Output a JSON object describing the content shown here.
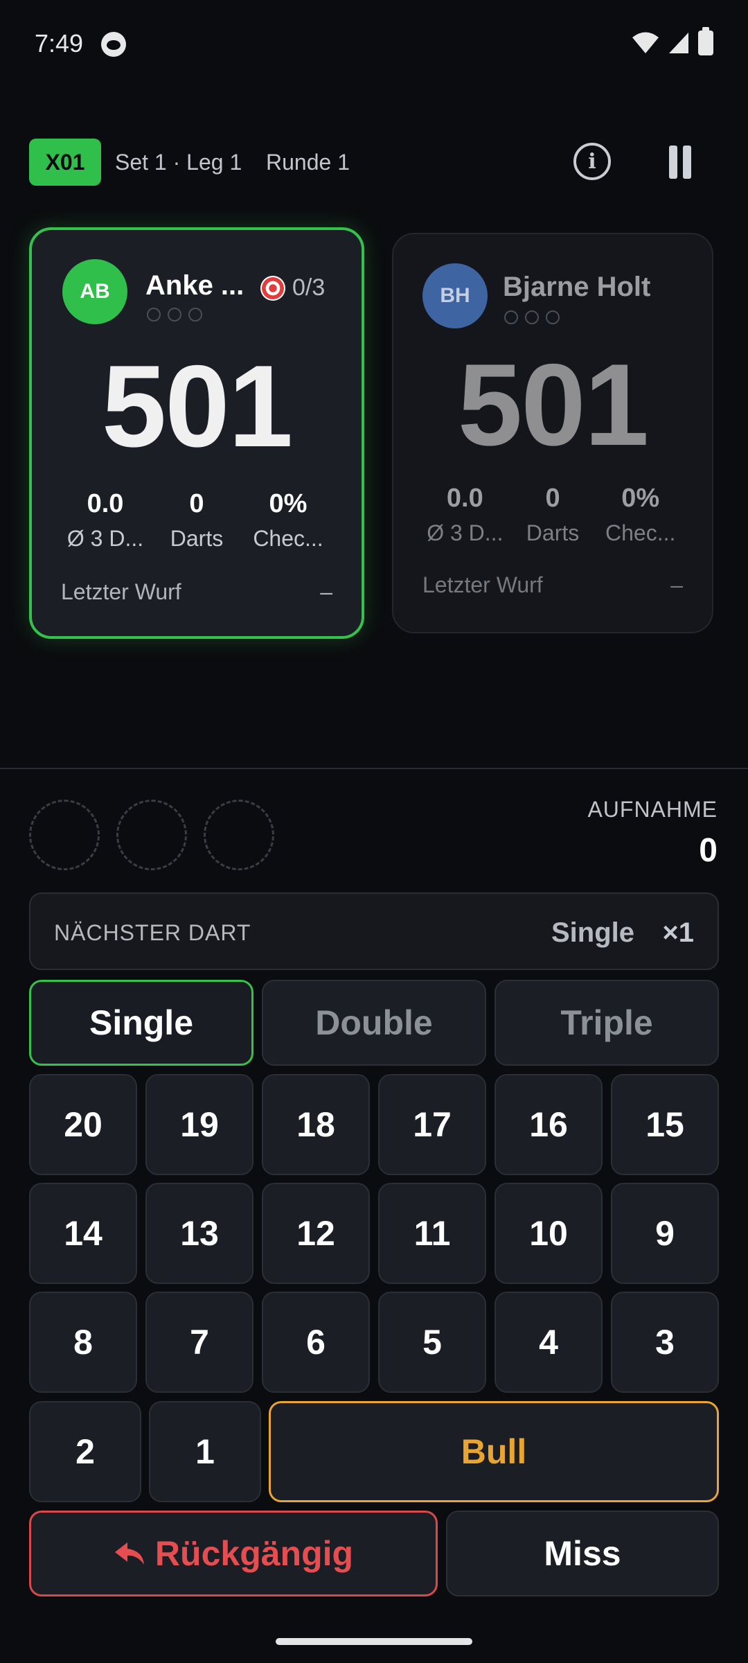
{
  "status_bar": {
    "time": "7:49"
  },
  "header": {
    "mode": "X01",
    "set_leg": "Set 1 · Leg 1",
    "round": "Runde 1"
  },
  "players": [
    {
      "initials": "AB",
      "name": "Anke ...",
      "checkout": "0/3",
      "score": "501",
      "stats": [
        {
          "value": "0.0",
          "label": "Ø 3 D..."
        },
        {
          "value": "0",
          "label": "Darts"
        },
        {
          "value": "0%",
          "label": "Chec..."
        }
      ],
      "last_throw_label": "Letzter Wurf",
      "last_throw_value": "–",
      "active": true
    },
    {
      "initials": "BH",
      "name": "Bjarne Holt",
      "score": "501",
      "stats": [
        {
          "value": "0.0",
          "label": "Ø 3 D..."
        },
        {
          "value": "0",
          "label": "Darts"
        },
        {
          "value": "0%",
          "label": "Chec..."
        }
      ],
      "last_throw_label": "Letzter Wurf",
      "last_throw_value": "–",
      "active": false
    }
  ],
  "turn": {
    "label": "AUFNAHME",
    "value": "0"
  },
  "next_dart": {
    "label": "NÄCHSTER DART",
    "mode": "Single",
    "multiplier": "×1"
  },
  "multipliers": [
    "Single",
    "Double",
    "Triple"
  ],
  "selected_multiplier": "Single",
  "numbers": {
    "row1": [
      "20",
      "19",
      "18",
      "17",
      "16",
      "15"
    ],
    "row2": [
      "14",
      "13",
      "12",
      "11",
      "10",
      "9"
    ],
    "row3": [
      "8",
      "7",
      "6",
      "5",
      "4",
      "3"
    ],
    "row4": [
      "2",
      "1"
    ]
  },
  "bull_label": "Bull",
  "undo_label": "Rückgängig",
  "miss_label": "Miss",
  "colors": {
    "accent_green": "#35c24c",
    "bull_orange": "#e8a532",
    "undo_red": "#e44e50",
    "player2_avatar": "#3e64a2"
  }
}
